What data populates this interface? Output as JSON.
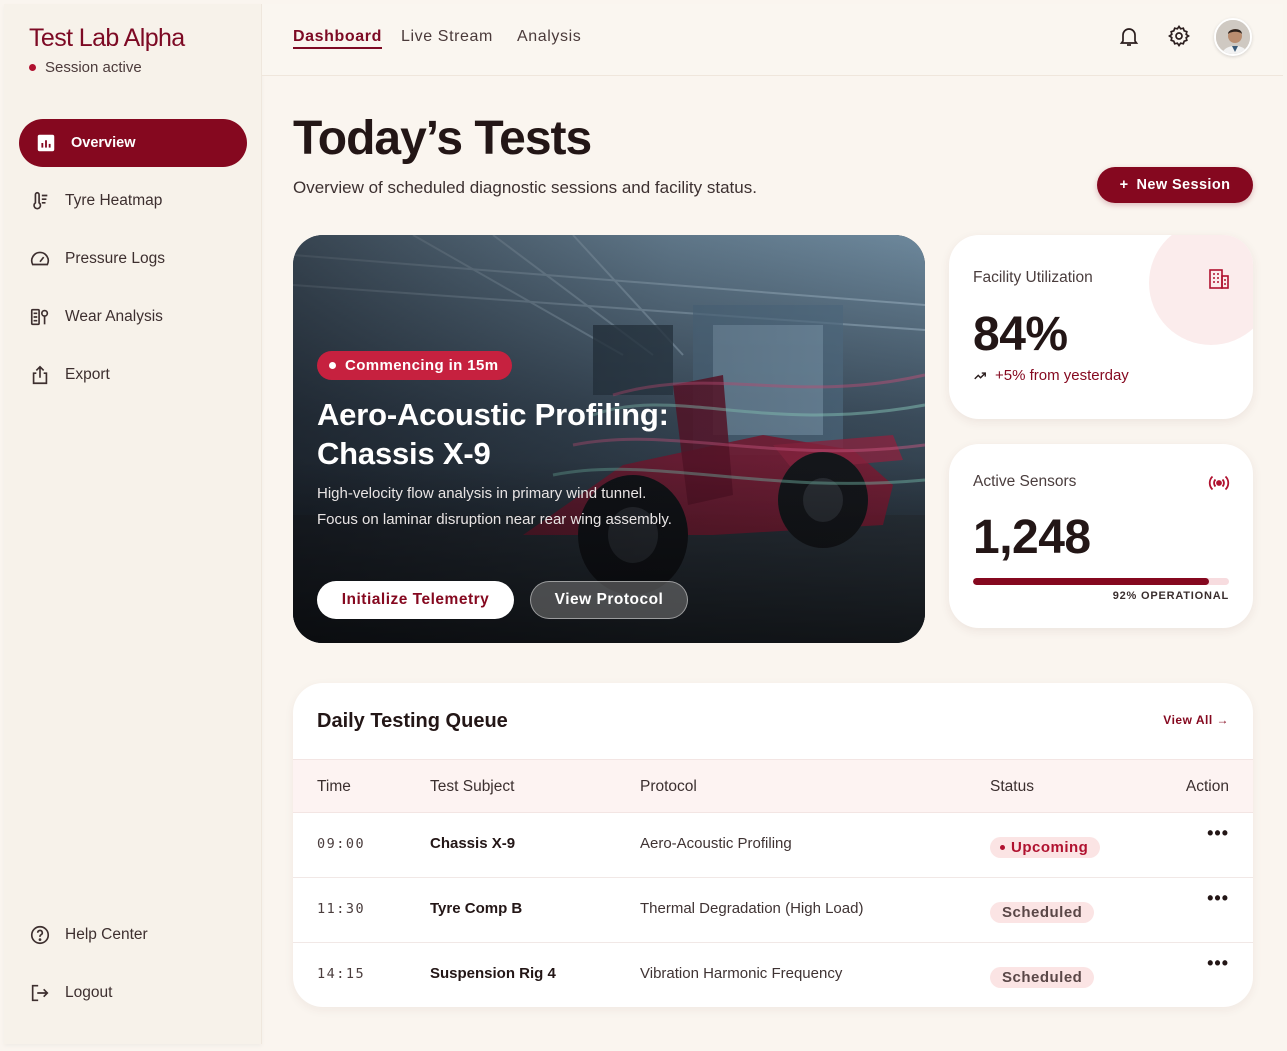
{
  "brand": {
    "title": "Test Lab Alpha",
    "status": "Session active"
  },
  "sidebar": {
    "items": [
      {
        "label": "Overview",
        "icon": "chart-icon"
      },
      {
        "label": "Tyre Heatmap",
        "icon": "thermometer-icon"
      },
      {
        "label": "Pressure Logs",
        "icon": "gauge-icon"
      },
      {
        "label": "Wear Analysis",
        "icon": "wear-icon"
      },
      {
        "label": "Export",
        "icon": "export-icon"
      }
    ],
    "footer": [
      {
        "label": "Help Center",
        "icon": "help-icon"
      },
      {
        "label": "Logout",
        "icon": "logout-icon"
      }
    ]
  },
  "topnav": {
    "tabs": [
      "Dashboard",
      "Live Stream",
      "Analysis"
    ]
  },
  "header": {
    "title": "Today’s Tests",
    "subtitle": "Overview of scheduled diagnostic sessions and facility status.",
    "new_session": "New Session"
  },
  "hero": {
    "badge": "Commencing in 15m",
    "title": "Aero-Acoustic Profiling: Chassis X-9",
    "description": "High-velocity flow analysis in primary wind tunnel. Focus on laminar disruption near rear wing assembly.",
    "primary_button": "Initialize Telemetry",
    "secondary_button": "View Protocol"
  },
  "stats": {
    "utilization": {
      "label": "Facility Utilization",
      "value": "84%",
      "trend": "+5% from yesterday"
    },
    "sensors": {
      "label": "Active Sensors",
      "value": "1,248",
      "operational_label": "92% OPERATIONAL",
      "operational_fraction": 0.92
    }
  },
  "queue": {
    "title": "Daily Testing Queue",
    "view_all": "View All",
    "columns": [
      "Time",
      "Test Subject",
      "Protocol",
      "Status",
      "Action"
    ],
    "rows": [
      {
        "time": "09:00",
        "subject": "Chassis X-9",
        "protocol": "Aero-Acoustic Profiling",
        "status": "Upcoming"
      },
      {
        "time": "11:30",
        "subject": "Tyre Comp B",
        "protocol": "Thermal Degradation (High Load)",
        "status": "Scheduled"
      },
      {
        "time": "14:15",
        "subject": "Suspension Rig 4",
        "protocol": "Vibration Harmonic Frequency",
        "status": "Scheduled"
      }
    ]
  },
  "colors": {
    "accent": "#85081f",
    "badge": "#c6213f",
    "background": "#faf5ef",
    "pill": "#fbe4e4"
  }
}
